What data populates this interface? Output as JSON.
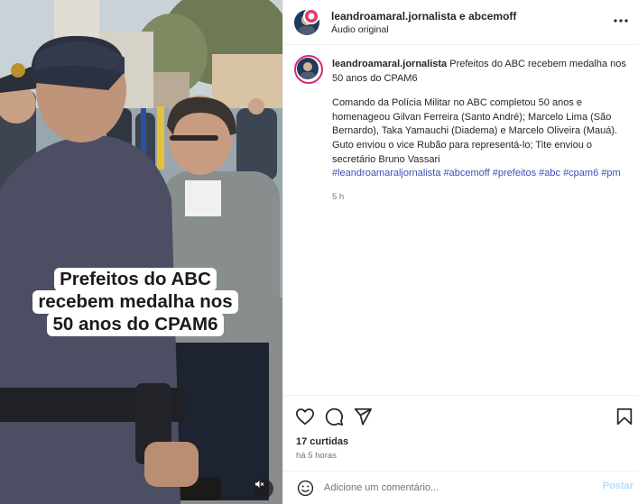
{
  "media": {
    "overlay_lines": [
      "Prefeitos do ABC",
      "recebem medalha nos",
      "50 anos do CPAM6"
    ],
    "mute_icon": "speaker-muted-icon"
  },
  "header": {
    "usernames": "leandroamaral.jornalista e abcemoff",
    "audio_label": "Áudio original",
    "more_icon": "more-horizontal-icon"
  },
  "caption": {
    "username": "leandroamaral.jornalista",
    "title": "Prefeitos do ABC recebem medalha nos 50 anos do CPAM6",
    "body": "Comando da Polícia Militar no ABC completou 50 anos e homenageou Gilvan Ferreira (Santo André); Marcelo Lima (São Bernardo), Taka Yamauchi (Diadema) e Marcelo Oliveira (Mauá). Guto enviou o vice Rubão para representá-lo; Tite enviou o secretário Bruno Vassari",
    "hashtags": [
      "#leandroamaraljornalista",
      "#abcemoff",
      "#prefeitos",
      "#abc",
      "#cpam6",
      "#pm"
    ],
    "time": "5 h"
  },
  "actions": {
    "like_icon": "heart-icon",
    "comment_icon": "comment-icon",
    "share_icon": "send-icon",
    "save_icon": "bookmark-icon"
  },
  "stats": {
    "likes": "17 curtidas",
    "posted_ago": "há 5 horas"
  },
  "add_comment": {
    "placeholder": "Adicione um comentário...",
    "post_label": "Postar",
    "emoji_icon": "emoji-smile-icon"
  },
  "colors": {
    "hashtag": "#3a50b8",
    "post_button_disabled": "#b2dffc",
    "secondary_text": "#737373",
    "story_ring": "#d62976"
  }
}
